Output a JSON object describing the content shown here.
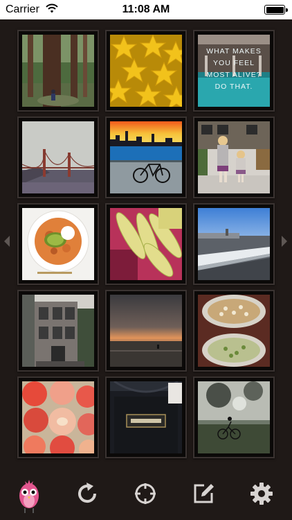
{
  "status_bar": {
    "carrier": "Carrier",
    "time": "11:08 AM",
    "wifi_icon": "wifi-icon",
    "battery_level": 1.0
  },
  "photo_grid": {
    "tiles": [
      {
        "subject": "redwood-forest-photo"
      },
      {
        "subject": "starfruit-slices-photo"
      },
      {
        "subject": "quote-poster-photo",
        "caption_lines": [
          "WHAT MAKES",
          "YOU FEEL",
          "MOST ALIVE?",
          "DO THAT."
        ]
      },
      {
        "subject": "golden-gate-bridge-fog-photo"
      },
      {
        "subject": "sunset-skyline-bicycle-photo"
      },
      {
        "subject": "two-children-photo"
      },
      {
        "subject": "avocado-dish-photo"
      },
      {
        "subject": "corn-cobs-photo"
      },
      {
        "subject": "airplane-wing-photo"
      },
      {
        "subject": "victorian-house-photo"
      },
      {
        "subject": "ocean-sunset-photo"
      },
      {
        "subject": "pasta-bowls-photo"
      },
      {
        "subject": "apples-photo"
      },
      {
        "subject": "black-handbag-photo"
      },
      {
        "subject": "cyclist-in-park-photo"
      }
    ]
  },
  "navigation": {
    "previous_icon": "chevron-left-icon",
    "next_icon": "chevron-right-icon"
  },
  "toolbar": {
    "items": [
      {
        "icon": "pink-bird-mascot-icon"
      },
      {
        "icon": "refresh-icon"
      },
      {
        "icon": "crosshair-icon"
      },
      {
        "icon": "compose-icon"
      },
      {
        "icon": "gear-icon"
      }
    ]
  },
  "colors": {
    "background": "#1f1917",
    "tile_frame": "#3a3331",
    "toolbar_icon": "#d7d3d1",
    "bird_pink": "#e2568f"
  }
}
